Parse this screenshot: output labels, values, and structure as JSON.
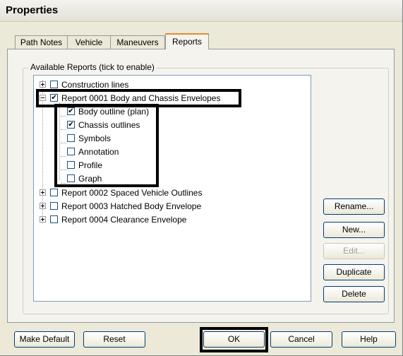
{
  "window": {
    "title": "Properties"
  },
  "tabs": [
    {
      "label": "Path Notes"
    },
    {
      "label": "Vehicle"
    },
    {
      "label": "Maneuvers"
    },
    {
      "label": "Reports",
      "active": true
    }
  ],
  "group": {
    "label": "Available Reports (tick to enable)"
  },
  "tree": [
    {
      "label": "Construction lines",
      "checked": false,
      "expander": "plus"
    },
    {
      "label": "Report 0001 Body and Chassis Envelopes",
      "checked": true,
      "expander": "minus"
    },
    {
      "label": "Body outline (plan)",
      "checked": true
    },
    {
      "label": "Chassis outlines",
      "checked": true
    },
    {
      "label": "Symbols",
      "checked": false
    },
    {
      "label": "Annotation",
      "checked": false
    },
    {
      "label": "Profile",
      "checked": false
    },
    {
      "label": "Graph",
      "checked": false
    },
    {
      "label": "Report 0002 Spaced Vehicle Outlines",
      "checked": false,
      "expander": "plus"
    },
    {
      "label": "Report 0003 Hatched Body Envelope",
      "checked": false,
      "expander": "plus"
    },
    {
      "label": "Report 0004 Clearance Envelope",
      "checked": false,
      "expander": "plus"
    }
  ],
  "side_buttons": {
    "rename": "Rename...",
    "new": "New...",
    "edit": "Edit...",
    "duplicate": "Duplicate",
    "delete": "Delete"
  },
  "bottom_buttons": {
    "make_default": "Make Default",
    "reset": "Reset",
    "ok": "OK",
    "cancel": "Cancel",
    "help": "Help"
  },
  "check_glyph": "✔"
}
